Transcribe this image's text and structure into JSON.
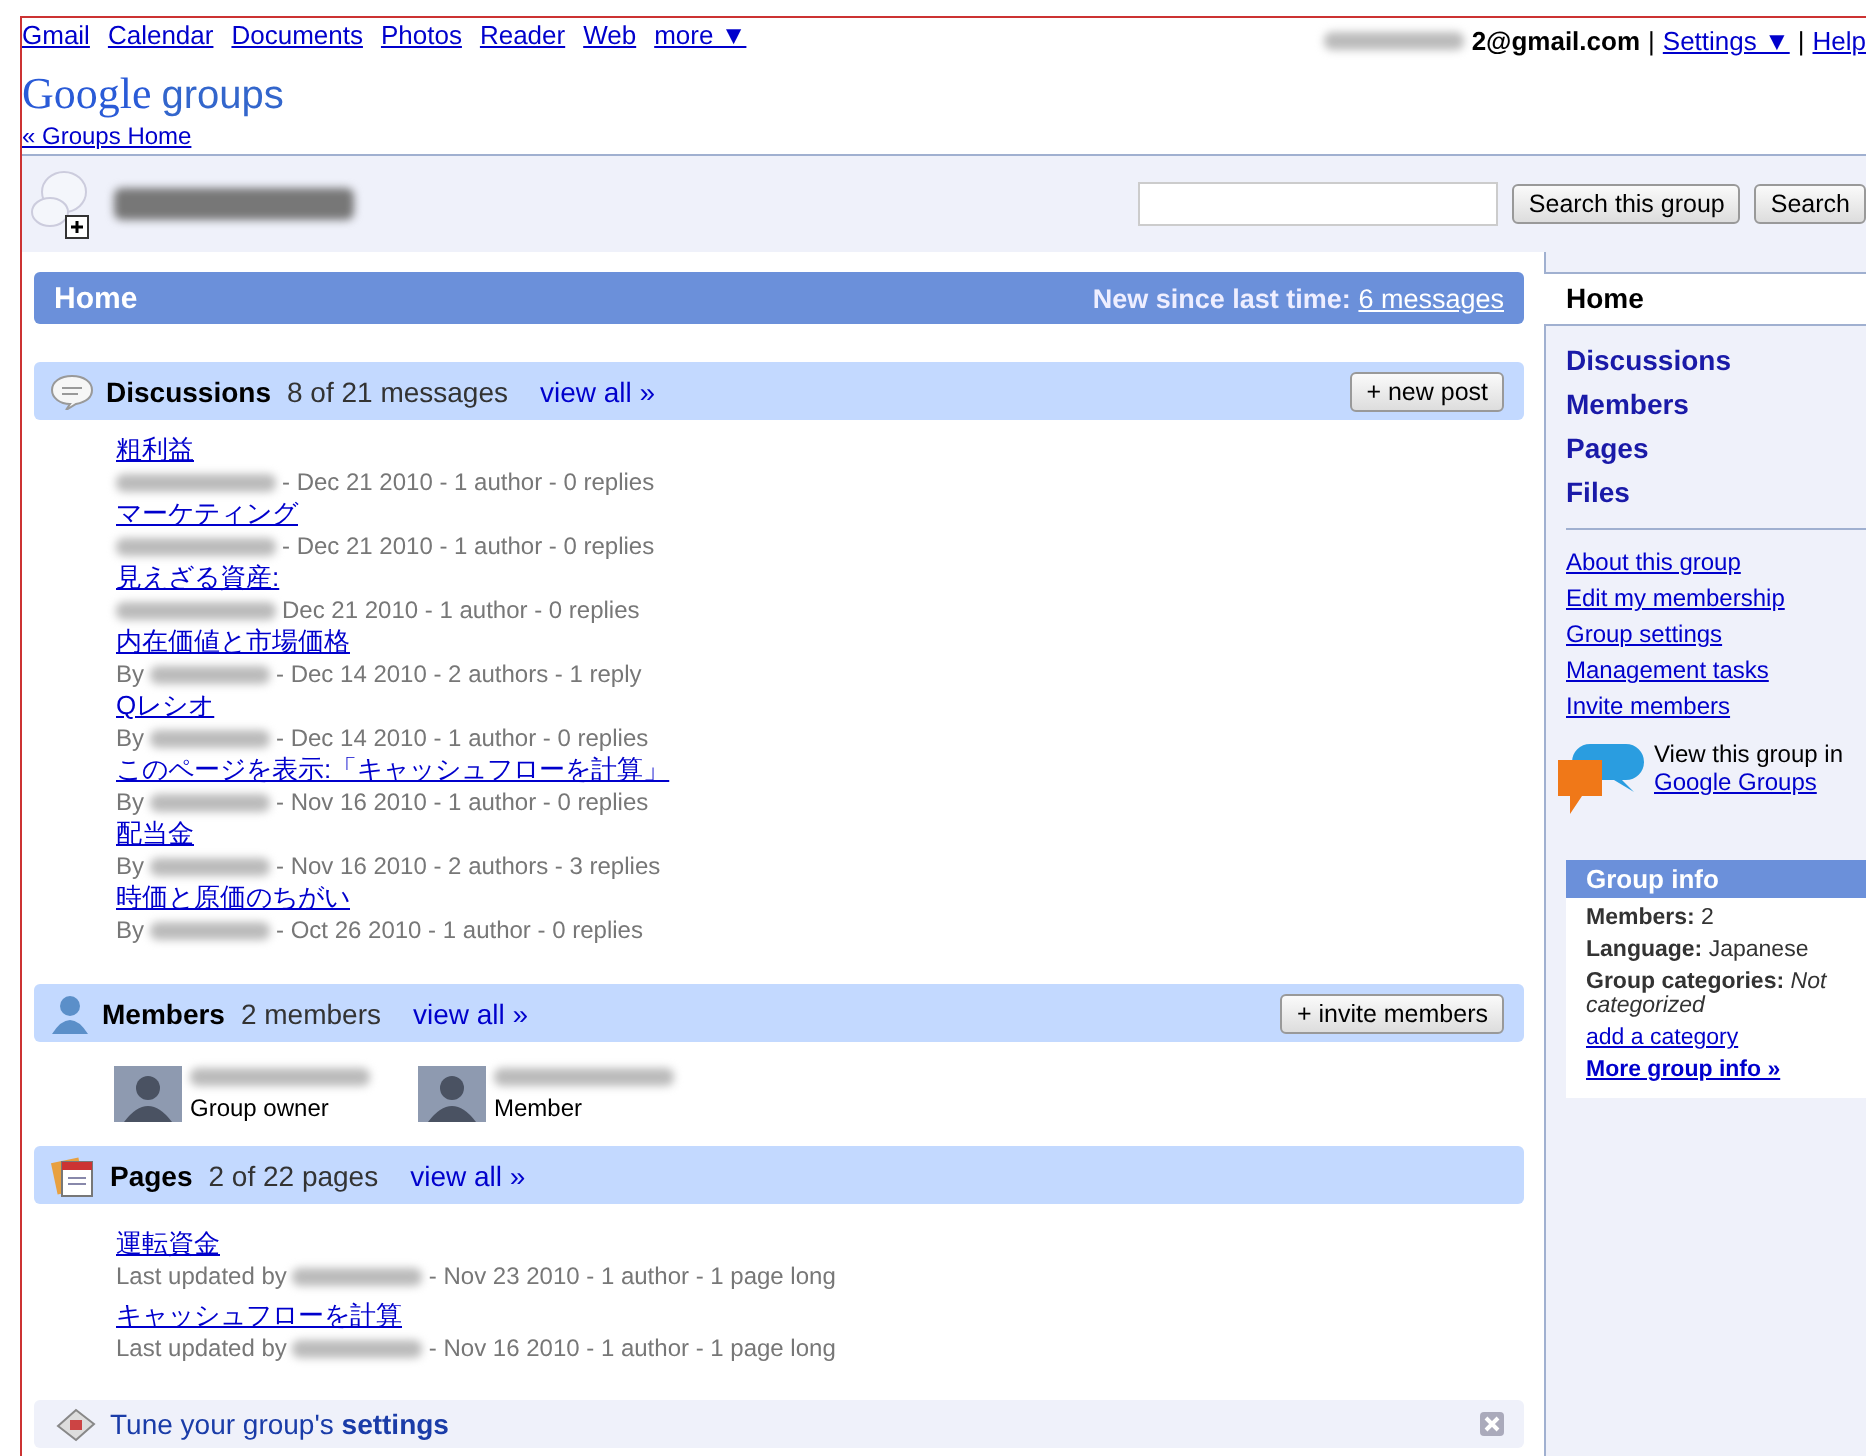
{
  "top_nav": {
    "links": [
      "Gmail",
      "Calendar",
      "Documents",
      "Photos",
      "Reader",
      "Web",
      "more ▼"
    ],
    "account": "2@gmail.com",
    "settings": "Settings ▼",
    "separator": "|",
    "help": "Help"
  },
  "logo": {
    "google": "Google",
    "product": "groups"
  },
  "groups_home_link": "« Groups Home",
  "group_header": {
    "search_button": "Search this group",
    "search2_button": "Search"
  },
  "home_bar": {
    "title": "Home",
    "new_label": "New since last time:",
    "new_link": "6 messages"
  },
  "discussions": {
    "title": "Discussions",
    "count": "8 of 21 messages",
    "view_all": "view all »",
    "button": "+ new post",
    "items": [
      {
        "title": "粗利益",
        "meta": "- Dec 21 2010 - 1 author - 0 replies"
      },
      {
        "title": "マーケティング",
        "meta": "- Dec 21 2010 - 1 author - 0 replies"
      },
      {
        "title": "見えざる資産:",
        "meta": "Dec 21 2010 - 1 author - 0 replies"
      },
      {
        "title": "内在価値と市場価格",
        "by": "By",
        "meta": "- Dec 14 2010 - 2 authors - 1 reply"
      },
      {
        "title": "Qレシオ",
        "by": "By",
        "meta": "- Dec 14 2010 - 1 author - 0 replies"
      },
      {
        "title": "このページを表示:「キャッシュフローを計算」",
        "by": "By",
        "meta": "- Nov 16 2010 - 1 author - 0 replies"
      },
      {
        "title": "配当金",
        "by": "By",
        "meta": "- Nov 16 2010 - 2 authors - 3 replies"
      },
      {
        "title": "時価と原価のちがい",
        "by": "By",
        "meta": "- Oct 26 2010 - 1 author - 0 replies"
      }
    ]
  },
  "members": {
    "title": "Members",
    "count": "2 members",
    "view_all": "view all »",
    "button": "+ invite members",
    "items": [
      {
        "role": "Group owner"
      },
      {
        "role": "Member"
      }
    ]
  },
  "pages": {
    "title": "Pages",
    "count": "2 of 22 pages",
    "view_all": "view all »",
    "items": [
      {
        "title": "運転資金",
        "by": "Last updated by",
        "meta": "- Nov 23 2010 - 1 author - 1 page long"
      },
      {
        "title": "キャッシュフローを計算",
        "by": "Last updated by",
        "meta": "- Nov 16 2010 - 1 author - 1 page long"
      }
    ]
  },
  "tune": {
    "text": "Tune your group's **settings**"
  },
  "sidebar": {
    "nav": [
      {
        "label": "Home",
        "selected": true
      },
      {
        "label": "Discussions",
        "selected": false
      },
      {
        "label": "Members",
        "selected": false
      },
      {
        "label": "Pages",
        "selected": false
      },
      {
        "label": "Files",
        "selected": false
      }
    ],
    "links": [
      "About this group",
      "Edit my membership",
      "Group settings",
      "Management tasks",
      "Invite members"
    ],
    "promo": {
      "text": "View this group in",
      "link": "Google Groups"
    },
    "group_info": {
      "title": "Group info",
      "rows": [
        {
          "label": "Members:",
          "value": "2",
          "kind": "plain"
        },
        {
          "label": "Language:",
          "value": "Japanese",
          "kind": "plain"
        },
        {
          "label": "Group categories:",
          "value": "Not categorized",
          "kind": "italic"
        }
      ],
      "links": [
        {
          "label": "add a category",
          "kind": "plain"
        },
        {
          "label": "More group info »",
          "kind": "bold"
        }
      ]
    }
  }
}
